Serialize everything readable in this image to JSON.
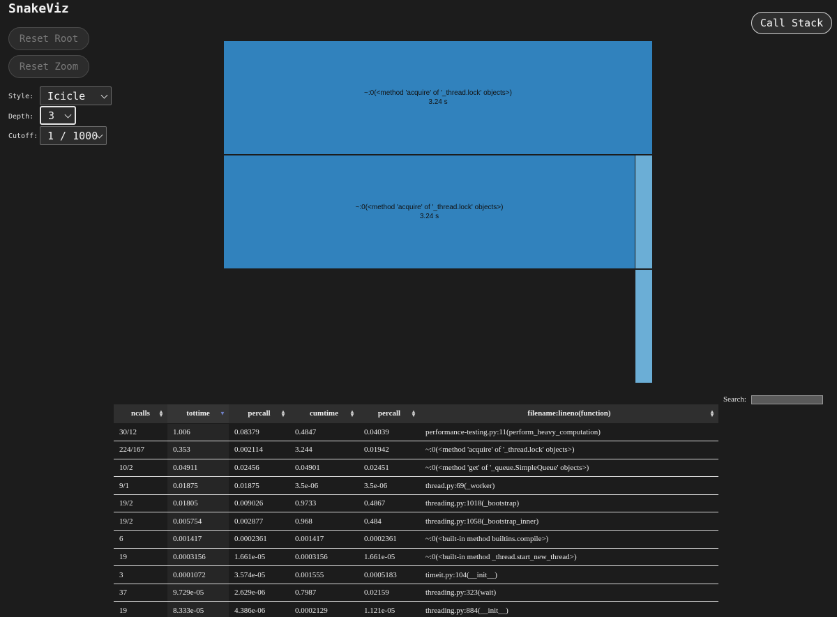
{
  "app": {
    "title": "SnakeViz"
  },
  "controls": {
    "reset_root_label": "Reset Root",
    "reset_zoom_label": "Reset Zoom",
    "style_label": "Style:",
    "style_value": "Icicle",
    "depth_label": "Depth:",
    "depth_value": "3",
    "cutoff_label": "Cutoff:",
    "cutoff_value": "1 / 1000",
    "call_stack_label": "Call Stack"
  },
  "viz": {
    "blocks": [
      {
        "name": "~:0(<method 'acquire' of '_thread.lock' objects>)",
        "time": "3.24 s"
      },
      {
        "name": "~:0(<method 'acquire' of '_thread.lock' objects>)",
        "time": "3.24 s"
      }
    ]
  },
  "colors": {
    "block": "#3182bd",
    "block_light": "#6baed6",
    "background": "#1c1c1c"
  },
  "search": {
    "label": "Search:",
    "value": ""
  },
  "table": {
    "headers": [
      "ncalls",
      "tottime",
      "percall",
      "cumtime",
      "percall",
      "filename:lineno(function)"
    ],
    "sorted_column": "tottime",
    "sort_direction": "descending",
    "rows": [
      [
        "30/12",
        "1.006",
        "0.08379",
        "0.4847",
        "0.04039",
        "performance-testing.py:11(perform_heavy_computation)"
      ],
      [
        "224/167",
        "0.353",
        "0.002114",
        "3.244",
        "0.01942",
        "~:0(<method 'acquire' of '_thread.lock' objects>)"
      ],
      [
        "10/2",
        "0.04911",
        "0.02456",
        "0.04901",
        "0.02451",
        "~:0(<method 'get' of '_queue.SimpleQueue' objects>)"
      ],
      [
        "9/1",
        "0.01875",
        "0.01875",
        "3.5e-06",
        "3.5e-06",
        "thread.py:69(_worker)"
      ],
      [
        "19/2",
        "0.01805",
        "0.009026",
        "0.9733",
        "0.4867",
        "threading.py:1018(_bootstrap)"
      ],
      [
        "19/2",
        "0.005754",
        "0.002877",
        "0.968",
        "0.484",
        "threading.py:1058(_bootstrap_inner)"
      ],
      [
        "6",
        "0.001417",
        "0.0002361",
        "0.001417",
        "0.0002361",
        "~:0(<built-in method builtins.compile>)"
      ],
      [
        "19",
        "0.0003156",
        "1.661e-05",
        "0.0003156",
        "1.661e-05",
        "~:0(<built-in method _thread.start_new_thread>)"
      ],
      [
        "3",
        "0.0001072",
        "3.574e-05",
        "0.001555",
        "0.0005183",
        "timeit.py:104(__init__)"
      ],
      [
        "37",
        "9.729e-05",
        "2.629e-06",
        "0.7987",
        "0.02159",
        "threading.py:323(wait)"
      ],
      [
        "19",
        "8.333e-05",
        "4.386e-06",
        "0.0002129",
        "1.121e-05",
        "threading.py:884(__init__)"
      ]
    ]
  }
}
